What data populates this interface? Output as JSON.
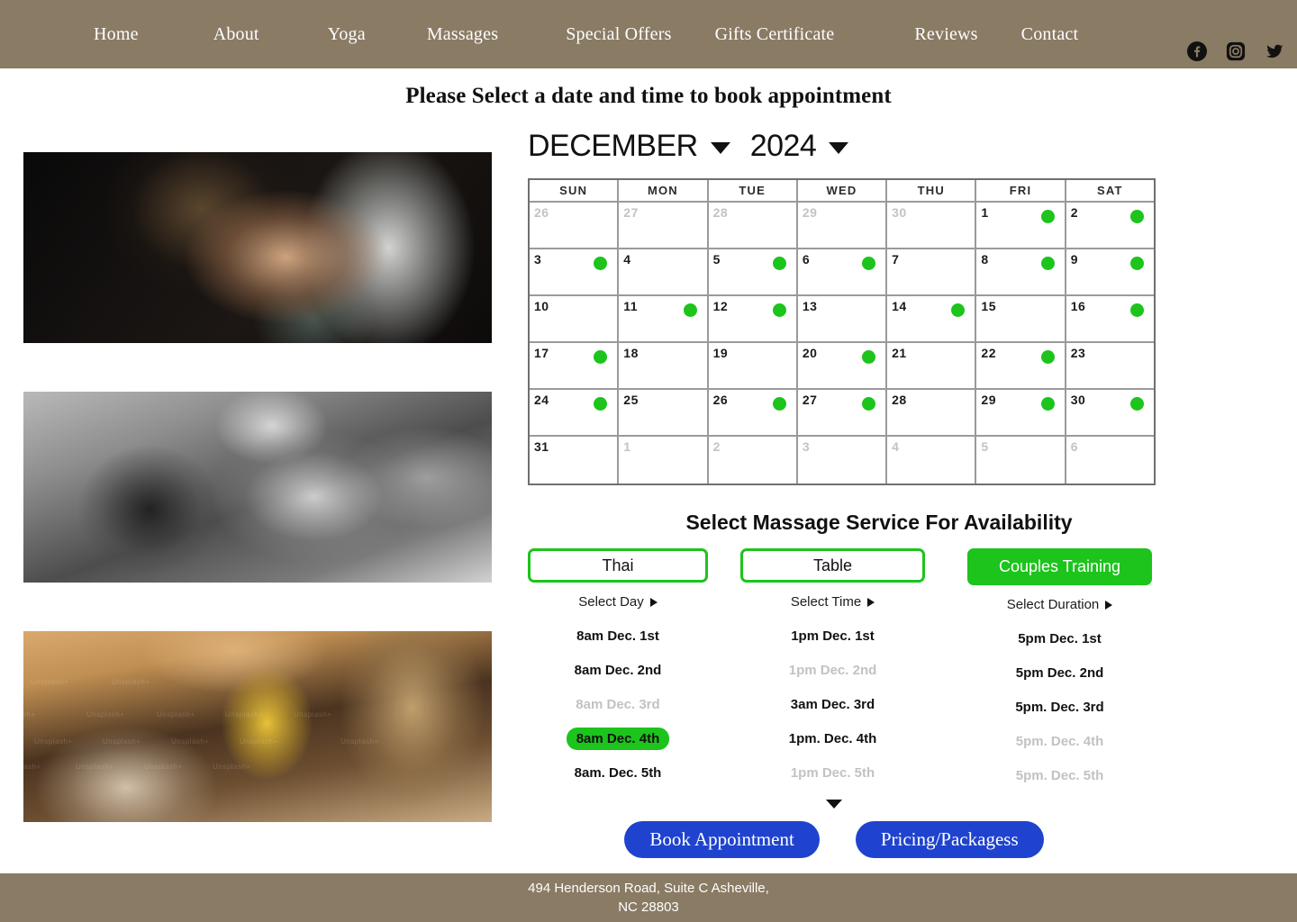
{
  "header": {
    "background_color": "#8a7b64",
    "nav_items": [
      {
        "label": "Home"
      },
      {
        "label": "About"
      },
      {
        "label": "Yoga"
      },
      {
        "label": "Massages"
      },
      {
        "label": "Special Offers"
      },
      {
        "label": "Gifts Certificate"
      },
      {
        "label": "Reviews"
      },
      {
        "label": "Contact"
      }
    ],
    "social": [
      {
        "name": "facebook-icon"
      },
      {
        "name": "instagram-icon"
      },
      {
        "name": "twitter-icon"
      }
    ]
  },
  "page_title": "Please Select a date and time to book appointment",
  "photos": [
    {
      "alt": "massage-photo-dark"
    },
    {
      "alt": "massage-photo-blackwhite"
    },
    {
      "alt": "massage-photo-spa"
    }
  ],
  "calendar": {
    "month": "DECEMBER",
    "year": "2024",
    "weekday_headers": [
      "SUN",
      "MON",
      "TUE",
      "WED",
      "THU",
      "FRI",
      "SAT"
    ],
    "available_dot_color": "#1cc41c",
    "weeks": [
      [
        {
          "day": "26",
          "muted": true,
          "available": false
        },
        {
          "day": "27",
          "muted": true,
          "available": false
        },
        {
          "day": "28",
          "muted": true,
          "available": false
        },
        {
          "day": "29",
          "muted": true,
          "available": false
        },
        {
          "day": "30",
          "muted": true,
          "available": false
        },
        {
          "day": "1",
          "muted": false,
          "available": true
        },
        {
          "day": "2",
          "muted": false,
          "available": true
        }
      ],
      [
        {
          "day": "3",
          "muted": false,
          "available": true
        },
        {
          "day": "4",
          "muted": false,
          "available": false
        },
        {
          "day": "5",
          "muted": false,
          "available": true
        },
        {
          "day": "6",
          "muted": false,
          "available": true
        },
        {
          "day": "7",
          "muted": false,
          "available": false
        },
        {
          "day": "8",
          "muted": false,
          "available": true
        },
        {
          "day": "9",
          "muted": false,
          "available": true
        }
      ],
      [
        {
          "day": "10",
          "muted": false,
          "available": false
        },
        {
          "day": "11",
          "muted": false,
          "available": true
        },
        {
          "day": "12",
          "muted": false,
          "available": true
        },
        {
          "day": "13",
          "muted": false,
          "available": false
        },
        {
          "day": "14",
          "muted": false,
          "available": true
        },
        {
          "day": "15",
          "muted": false,
          "available": false
        },
        {
          "day": "16",
          "muted": false,
          "available": true
        }
      ],
      [
        {
          "day": "17",
          "muted": false,
          "available": true
        },
        {
          "day": "18",
          "muted": false,
          "available": false
        },
        {
          "day": "19",
          "muted": false,
          "available": false
        },
        {
          "day": "20",
          "muted": false,
          "available": true
        },
        {
          "day": "21",
          "muted": false,
          "available": false
        },
        {
          "day": "22",
          "muted": false,
          "available": true
        },
        {
          "day": "23",
          "muted": false,
          "available": false
        }
      ],
      [
        {
          "day": "24",
          "muted": false,
          "available": true
        },
        {
          "day": "25",
          "muted": false,
          "available": false
        },
        {
          "day": "26",
          "muted": false,
          "available": true
        },
        {
          "day": "27",
          "muted": false,
          "available": true
        },
        {
          "day": "28",
          "muted": false,
          "available": false
        },
        {
          "day": "29",
          "muted": false,
          "available": true
        },
        {
          "day": "30",
          "muted": false,
          "available": true
        }
      ],
      [
        {
          "day": "31",
          "muted": false,
          "available": false
        },
        {
          "day": "1",
          "muted": true,
          "available": false
        },
        {
          "day": "2",
          "muted": true,
          "available": false
        },
        {
          "day": "3",
          "muted": true,
          "available": false
        },
        {
          "day": "4",
          "muted": true,
          "available": false
        },
        {
          "day": "5",
          "muted": true,
          "available": false
        },
        {
          "day": "6",
          "muted": true,
          "available": false
        }
      ]
    ]
  },
  "service": {
    "title": "Select Massage Service For Availability",
    "accent_color": "#1cc41c",
    "columns": [
      {
        "button_label": "Thai",
        "selected": false,
        "sub_label": "Select Day",
        "slots": [
          {
            "label": "8am Dec. 1st",
            "state": "normal"
          },
          {
            "label": "8am Dec. 2nd",
            "state": "normal"
          },
          {
            "label": "8am Dec. 3rd",
            "state": "disabled"
          },
          {
            "label": "8am Dec. 4th",
            "state": "active"
          },
          {
            "label": "8am. Dec. 5th",
            "state": "normal"
          }
        ]
      },
      {
        "button_label": "Table",
        "selected": false,
        "sub_label": "Select Time",
        "slots": [
          {
            "label": "1pm Dec. 1st",
            "state": "normal"
          },
          {
            "label": "1pm Dec. 2nd",
            "state": "disabled"
          },
          {
            "label": "3am Dec. 3rd",
            "state": "normal"
          },
          {
            "label": "1pm. Dec. 4th",
            "state": "normal"
          },
          {
            "label": "1pm Dec. 5th",
            "state": "disabled"
          }
        ]
      },
      {
        "button_label": "Couples Training",
        "selected": true,
        "sub_label": "Select Duration",
        "slots": [
          {
            "label": "5pm Dec. 1st",
            "state": "normal"
          },
          {
            "label": "5pm Dec. 2nd",
            "state": "normal"
          },
          {
            "label": "5pm. Dec. 3rd",
            "state": "normal"
          },
          {
            "label": "5pm. Dec. 4th",
            "state": "disabled"
          },
          {
            "label": "5pm. Dec. 5th",
            "state": "disabled"
          }
        ]
      }
    ]
  },
  "actions": {
    "book_label": "Book Appointment",
    "pricing_label": "Pricing/Packagess",
    "button_color": "#1f43cf"
  },
  "footer": {
    "line1": "494 Henderson Road, Suite C Asheville,",
    "line2": "NC 28803"
  }
}
